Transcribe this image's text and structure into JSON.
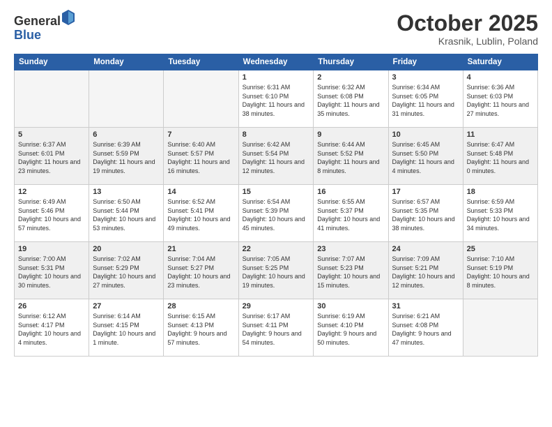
{
  "header": {
    "logo_general": "General",
    "logo_blue": "Blue",
    "month_title": "October 2025",
    "location": "Krasnik, Lublin, Poland"
  },
  "days_of_week": [
    "Sunday",
    "Monday",
    "Tuesday",
    "Wednesday",
    "Thursday",
    "Friday",
    "Saturday"
  ],
  "weeks": [
    [
      {
        "day": "",
        "info": ""
      },
      {
        "day": "",
        "info": ""
      },
      {
        "day": "",
        "info": ""
      },
      {
        "day": "1",
        "info": "Sunrise: 6:31 AM\nSunset: 6:10 PM\nDaylight: 11 hours\nand 38 minutes."
      },
      {
        "day": "2",
        "info": "Sunrise: 6:32 AM\nSunset: 6:08 PM\nDaylight: 11 hours\nand 35 minutes."
      },
      {
        "day": "3",
        "info": "Sunrise: 6:34 AM\nSunset: 6:05 PM\nDaylight: 11 hours\nand 31 minutes."
      },
      {
        "day": "4",
        "info": "Sunrise: 6:36 AM\nSunset: 6:03 PM\nDaylight: 11 hours\nand 27 minutes."
      }
    ],
    [
      {
        "day": "5",
        "info": "Sunrise: 6:37 AM\nSunset: 6:01 PM\nDaylight: 11 hours\nand 23 minutes."
      },
      {
        "day": "6",
        "info": "Sunrise: 6:39 AM\nSunset: 5:59 PM\nDaylight: 11 hours\nand 19 minutes."
      },
      {
        "day": "7",
        "info": "Sunrise: 6:40 AM\nSunset: 5:57 PM\nDaylight: 11 hours\nand 16 minutes."
      },
      {
        "day": "8",
        "info": "Sunrise: 6:42 AM\nSunset: 5:54 PM\nDaylight: 11 hours\nand 12 minutes."
      },
      {
        "day": "9",
        "info": "Sunrise: 6:44 AM\nSunset: 5:52 PM\nDaylight: 11 hours\nand 8 minutes."
      },
      {
        "day": "10",
        "info": "Sunrise: 6:45 AM\nSunset: 5:50 PM\nDaylight: 11 hours\nand 4 minutes."
      },
      {
        "day": "11",
        "info": "Sunrise: 6:47 AM\nSunset: 5:48 PM\nDaylight: 11 hours\nand 0 minutes."
      }
    ],
    [
      {
        "day": "12",
        "info": "Sunrise: 6:49 AM\nSunset: 5:46 PM\nDaylight: 10 hours\nand 57 minutes."
      },
      {
        "day": "13",
        "info": "Sunrise: 6:50 AM\nSunset: 5:44 PM\nDaylight: 10 hours\nand 53 minutes."
      },
      {
        "day": "14",
        "info": "Sunrise: 6:52 AM\nSunset: 5:41 PM\nDaylight: 10 hours\nand 49 minutes."
      },
      {
        "day": "15",
        "info": "Sunrise: 6:54 AM\nSunset: 5:39 PM\nDaylight: 10 hours\nand 45 minutes."
      },
      {
        "day": "16",
        "info": "Sunrise: 6:55 AM\nSunset: 5:37 PM\nDaylight: 10 hours\nand 41 minutes."
      },
      {
        "day": "17",
        "info": "Sunrise: 6:57 AM\nSunset: 5:35 PM\nDaylight: 10 hours\nand 38 minutes."
      },
      {
        "day": "18",
        "info": "Sunrise: 6:59 AM\nSunset: 5:33 PM\nDaylight: 10 hours\nand 34 minutes."
      }
    ],
    [
      {
        "day": "19",
        "info": "Sunrise: 7:00 AM\nSunset: 5:31 PM\nDaylight: 10 hours\nand 30 minutes."
      },
      {
        "day": "20",
        "info": "Sunrise: 7:02 AM\nSunset: 5:29 PM\nDaylight: 10 hours\nand 27 minutes."
      },
      {
        "day": "21",
        "info": "Sunrise: 7:04 AM\nSunset: 5:27 PM\nDaylight: 10 hours\nand 23 minutes."
      },
      {
        "day": "22",
        "info": "Sunrise: 7:05 AM\nSunset: 5:25 PM\nDaylight: 10 hours\nand 19 minutes."
      },
      {
        "day": "23",
        "info": "Sunrise: 7:07 AM\nSunset: 5:23 PM\nDaylight: 10 hours\nand 15 minutes."
      },
      {
        "day": "24",
        "info": "Sunrise: 7:09 AM\nSunset: 5:21 PM\nDaylight: 10 hours\nand 12 minutes."
      },
      {
        "day": "25",
        "info": "Sunrise: 7:10 AM\nSunset: 5:19 PM\nDaylight: 10 hours\nand 8 minutes."
      }
    ],
    [
      {
        "day": "26",
        "info": "Sunrise: 6:12 AM\nSunset: 4:17 PM\nDaylight: 10 hours\nand 4 minutes."
      },
      {
        "day": "27",
        "info": "Sunrise: 6:14 AM\nSunset: 4:15 PM\nDaylight: 10 hours\nand 1 minute."
      },
      {
        "day": "28",
        "info": "Sunrise: 6:15 AM\nSunset: 4:13 PM\nDaylight: 9 hours\nand 57 minutes."
      },
      {
        "day": "29",
        "info": "Sunrise: 6:17 AM\nSunset: 4:11 PM\nDaylight: 9 hours\nand 54 minutes."
      },
      {
        "day": "30",
        "info": "Sunrise: 6:19 AM\nSunset: 4:10 PM\nDaylight: 9 hours\nand 50 minutes."
      },
      {
        "day": "31",
        "info": "Sunrise: 6:21 AM\nSunset: 4:08 PM\nDaylight: 9 hours\nand 47 minutes."
      },
      {
        "day": "",
        "info": ""
      }
    ]
  ]
}
